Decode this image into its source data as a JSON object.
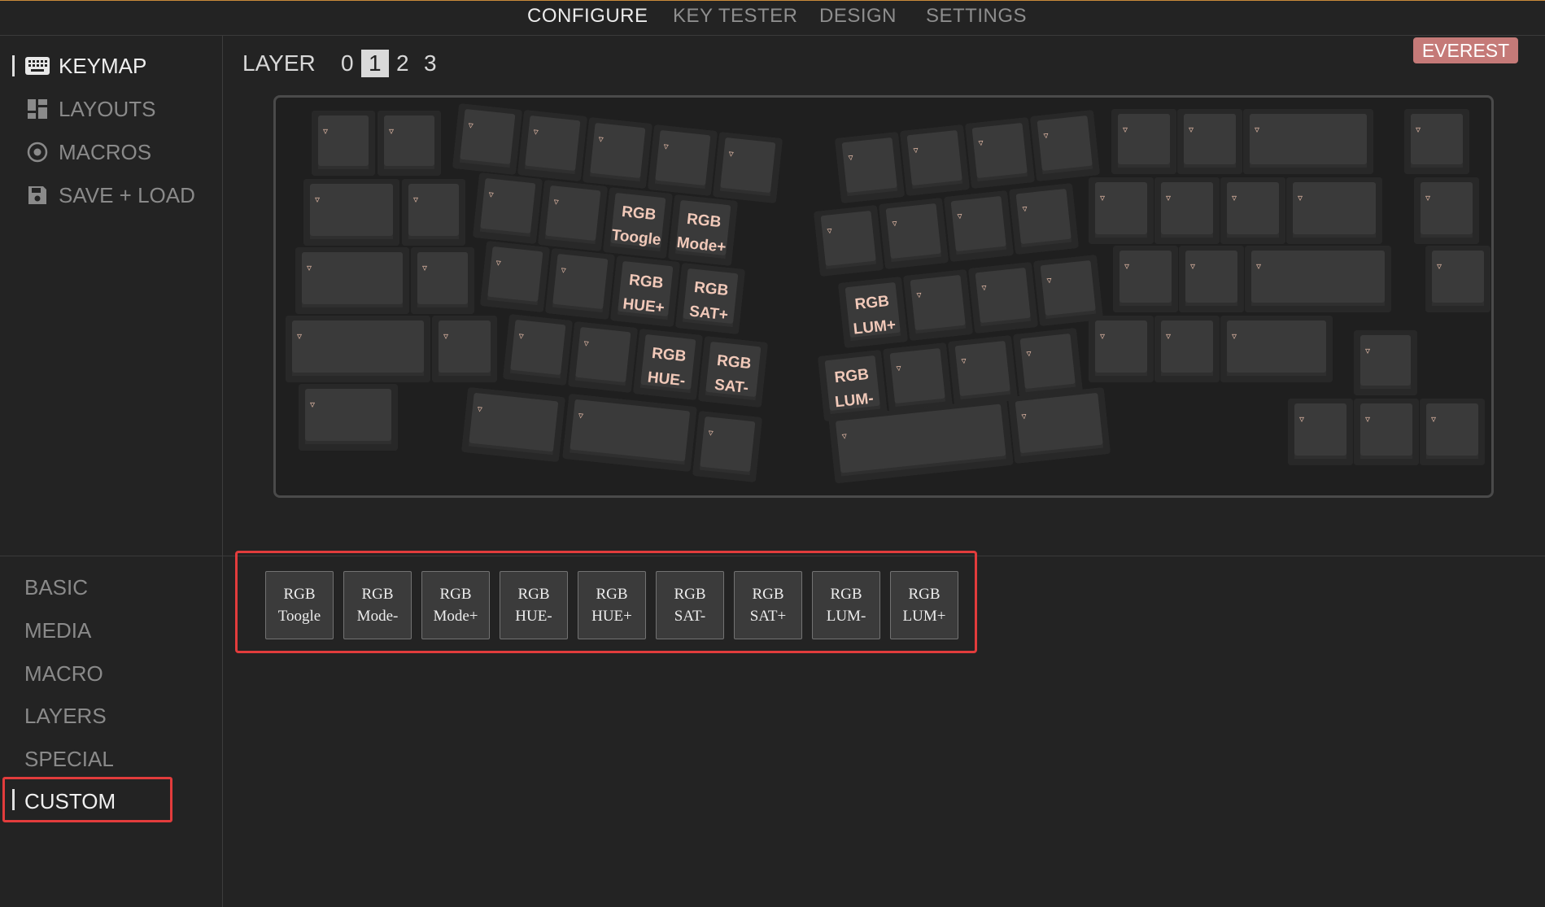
{
  "topnav": {
    "tabs": [
      {
        "label": "CONFIGURE",
        "active": true
      },
      {
        "label": "KEY TESTER"
      },
      {
        "label": "DESIGN"
      },
      {
        "label": "SETTINGS"
      }
    ]
  },
  "sidebar": {
    "items": [
      {
        "label": "KEYMAP",
        "icon": "keyboard-icon",
        "active": true
      },
      {
        "label": "LAYOUTS",
        "icon": "layouts-icon"
      },
      {
        "label": "MACROS",
        "icon": "macros-icon"
      },
      {
        "label": "SAVE + LOAD",
        "icon": "save-icon"
      }
    ]
  },
  "categories": [
    {
      "label": "BASIC"
    },
    {
      "label": "MEDIA"
    },
    {
      "label": "MACRO"
    },
    {
      "label": "LAYERS"
    },
    {
      "label": "SPECIAL"
    },
    {
      "label": "CUSTOM",
      "active": true
    }
  ],
  "layer": {
    "label": "LAYER",
    "options": [
      "0",
      "1",
      "2",
      "3"
    ],
    "selected": "1"
  },
  "device_badge": "EVEREST",
  "keyboard": {
    "key_marker": "▿",
    "assigned": [
      [
        "RGB",
        "Toogle"
      ],
      [
        "RGB",
        "Mode+"
      ],
      [
        "RGB",
        "HUE+"
      ],
      [
        "RGB",
        "SAT+"
      ],
      [
        "RGB",
        "HUE-"
      ],
      [
        "RGB",
        "SAT-"
      ],
      [
        "RGB",
        "LUM+"
      ],
      [
        "RGB",
        "LUM-"
      ]
    ]
  },
  "palette": {
    "keys": [
      {
        "line1": "RGB",
        "line2": "Toogle"
      },
      {
        "line1": "RGB",
        "line2": "Mode-"
      },
      {
        "line1": "RGB",
        "line2": "Mode+"
      },
      {
        "line1": "RGB",
        "line2": "HUE-"
      },
      {
        "line1": "RGB",
        "line2": "HUE+"
      },
      {
        "line1": "RGB",
        "line2": "SAT-"
      },
      {
        "line1": "RGB",
        "line2": "SAT+"
      },
      {
        "line1": "RGB",
        "line2": "LUM-"
      },
      {
        "line1": "RGB",
        "line2": "LUM+"
      }
    ]
  },
  "colors": {
    "background": "#232323",
    "highlight": "#e23c3c",
    "badge": "#c57a78",
    "key_label": "#f1c9b9"
  }
}
